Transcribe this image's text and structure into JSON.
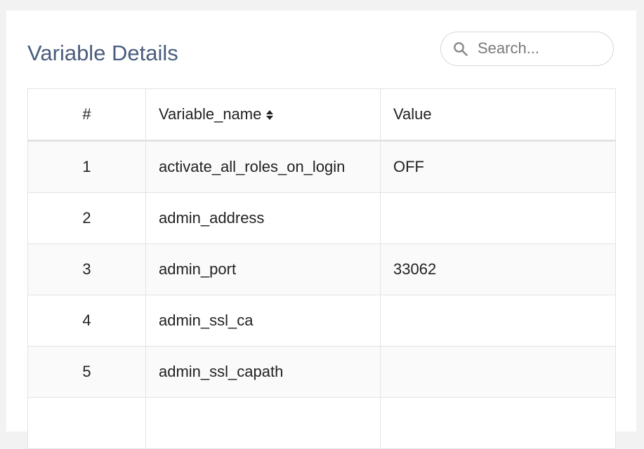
{
  "page": {
    "title": "Variable Details"
  },
  "search": {
    "placeholder": "Search..."
  },
  "table": {
    "columns": [
      "#",
      "Variable_name",
      "Value"
    ],
    "rows": [
      {
        "num": "1",
        "name": "activate_all_roles_on_login",
        "value": "OFF"
      },
      {
        "num": "2",
        "name": "admin_address",
        "value": ""
      },
      {
        "num": "3",
        "name": "admin_port",
        "value": "33062"
      },
      {
        "num": "4",
        "name": "admin_ssl_ca",
        "value": ""
      },
      {
        "num": "5",
        "name": "admin_ssl_capath",
        "value": ""
      },
      {
        "num": "",
        "name": "",
        "value": ""
      }
    ]
  },
  "icons": {
    "search": "search-icon",
    "sort": "sort-icon"
  },
  "colors": {
    "title": "#4a5d7e",
    "background": "#f2f2f2",
    "row_stripe": "#fafafa",
    "border": "#e3e3e3"
  }
}
